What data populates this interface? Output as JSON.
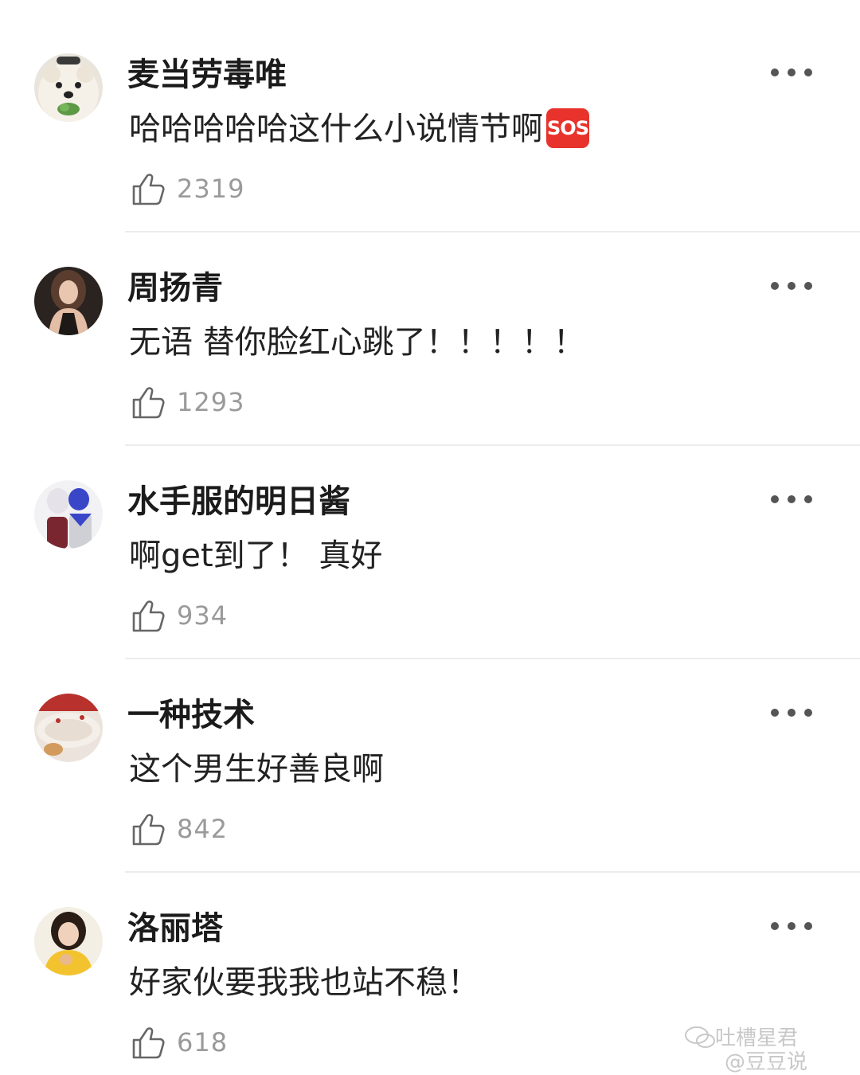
{
  "comments": [
    {
      "username": "麦当劳毒唯",
      "text": "哈哈哈哈哈这什么小说情节啊",
      "emoji": "SOS",
      "likes": "2319",
      "avatar_icon": "dog-avatar"
    },
    {
      "username": "周扬青",
      "text": "无语 替你脸红心跳了！！！！！",
      "likes": "1293",
      "avatar_icon": "woman-portrait-avatar"
    },
    {
      "username": "水手服的明日酱",
      "text": "啊get到了！ 真好",
      "likes": "934",
      "avatar_icon": "anime-couple-avatar"
    },
    {
      "username": "一种技术",
      "text": "这个男生好善良啊",
      "likes": "842",
      "avatar_icon": "cake-avatar"
    },
    {
      "username": "洛丽塔",
      "text": "好家伙要我我也站不稳！",
      "likes": "618",
      "avatar_icon": "girl-yellow-avatar"
    }
  ],
  "watermark": {
    "line1": "吐槽星君",
    "line2": "@豆豆说"
  },
  "colors": {
    "text": "#1b1b1b",
    "muted": "#9a9a9a",
    "divider": "#ececec",
    "sos": "#e8332c"
  }
}
